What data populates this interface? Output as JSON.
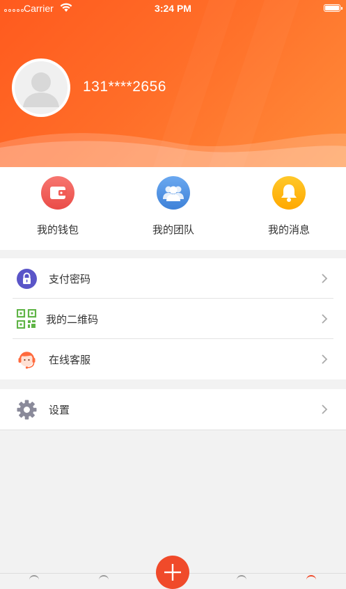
{
  "status_bar": {
    "carrier": "Carrier",
    "time": "3:24 PM",
    "battery_level": 1.0
  },
  "profile": {
    "phone": "131****2656",
    "avatar_icon": "default-user-avatar"
  },
  "colors": {
    "header_gradient_start": "#ff5a1e",
    "header_gradient_end": "#ff8c3a",
    "wallet": "#f25a55",
    "team": "#4a8fe0",
    "message": "#ffb300",
    "pay_password": "#5a55c8",
    "qr_code": "#5fb446",
    "service": "#ff6a3d",
    "settings": "#8a8a9a",
    "fab": "#f04a2a"
  },
  "quick_actions": [
    {
      "label": "我的钱包",
      "icon": "wallet-icon"
    },
    {
      "label": "我的团队",
      "icon": "team-icon"
    },
    {
      "label": "我的消息",
      "icon": "bell-icon"
    }
  ],
  "menu": {
    "group1": [
      {
        "label": "支付密码",
        "icon": "lock-icon"
      },
      {
        "label": "我的二维码",
        "icon": "qr-code-icon"
      },
      {
        "label": "在线客服",
        "icon": "customer-service-icon"
      }
    ],
    "group2": [
      {
        "label": "设置",
        "icon": "gear-icon"
      }
    ]
  },
  "tabbar": {
    "center_button_icon": "plus-icon"
  }
}
